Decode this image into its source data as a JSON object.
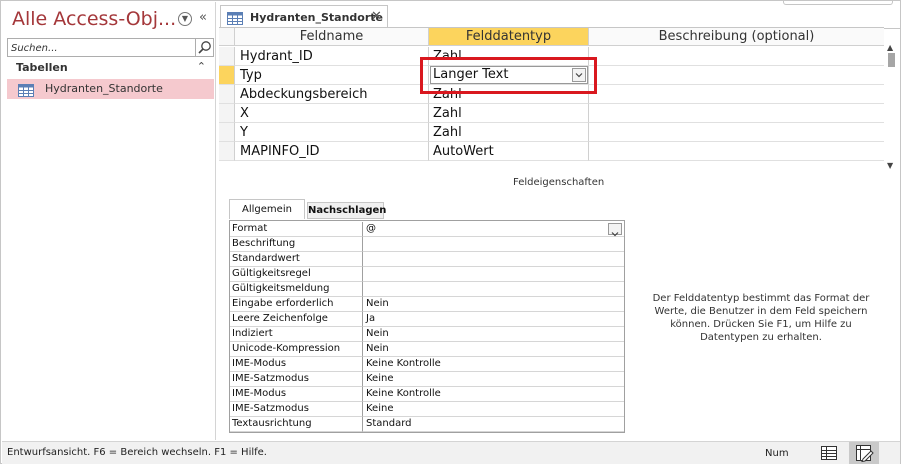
{
  "nav": {
    "title": "Alle Access-Obj...",
    "search_placeholder": "Suchen...",
    "group_label": "Tabellen",
    "items": [
      {
        "label": "Hydranten_Standorte",
        "icon": "table-icon"
      }
    ]
  },
  "tab": {
    "label": "Hydranten_Standorte",
    "icon": "table-icon"
  },
  "grid": {
    "headers": {
      "name": "Feldname",
      "type": "Felddatentyp",
      "desc": "Beschreibung (optional)"
    },
    "rows": [
      {
        "name": "Hydrant_ID",
        "type": "Zahl"
      },
      {
        "name": "Typ",
        "type": "Langer Text"
      },
      {
        "name": "Abdeckungsbereich",
        "type": "Zahl"
      },
      {
        "name": "X",
        "type": "Zahl"
      },
      {
        "name": "Y",
        "type": "Zahl"
      },
      {
        "name": "MAPINFO_ID",
        "type": "AutoWert"
      }
    ],
    "selected_row": 1,
    "combo_value": "Langer Text"
  },
  "props": {
    "caption": "Feldeigenschaften",
    "tabs": [
      "Allgemein",
      "Nachschlagen"
    ],
    "rows": [
      {
        "label": "Format",
        "value": "@"
      },
      {
        "label": "Beschriftung",
        "value": ""
      },
      {
        "label": "Standardwert",
        "value": ""
      },
      {
        "label": "Gültigkeitsregel",
        "value": ""
      },
      {
        "label": "Gültigkeitsmeldung",
        "value": ""
      },
      {
        "label": "Eingabe erforderlich",
        "value": "Nein"
      },
      {
        "label": "Leere Zeichenfolge",
        "value": "Ja"
      },
      {
        "label": "Indiziert",
        "value": "Nein"
      },
      {
        "label": "Unicode-Kompression",
        "value": "Nein"
      },
      {
        "label": "IME-Modus",
        "value": "Keine Kontrolle"
      },
      {
        "label": "IME-Satzmodus",
        "value": "Keine"
      },
      {
        "label": "IME-Modus",
        "value": "Keine Kontrolle"
      },
      {
        "label": "IME-Satzmodus",
        "value": "Keine"
      },
      {
        "label": "Textausrichtung",
        "value": "Standard"
      }
    ],
    "help": "Der Felddatentyp bestimmt das Format der Werte, die Benutzer in dem Feld speichern können. Drücken Sie F1, um Hilfe zu Datentypen zu erhalten."
  },
  "status": {
    "text": "Entwurfsansicht. F6 = Bereich wechseln. F1 = Hilfe.",
    "num": "Num"
  },
  "colors": {
    "accent": "#a4373a",
    "header_selected": "#fcd45d",
    "nav_selected": "#f5c9ce",
    "highlight": "#d9181f"
  }
}
